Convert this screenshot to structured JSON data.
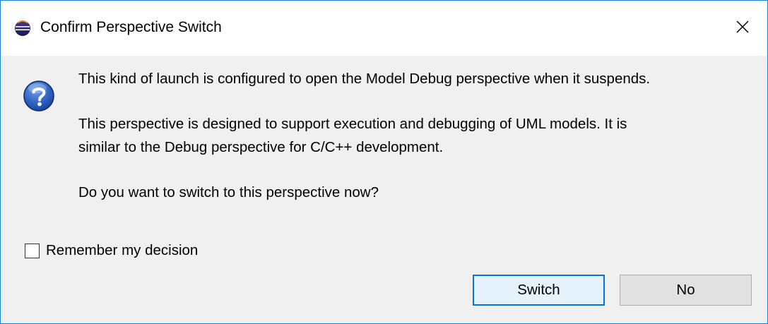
{
  "window": {
    "title": "Confirm Perspective Switch",
    "app_icon": "eclipse-icon",
    "close_icon": "close-icon"
  },
  "dialog": {
    "icon": "question-icon",
    "message_line1": "This kind of launch is configured to open the Model Debug perspective when it suspends.",
    "message_line2": "This perspective is designed to support execution and debugging of UML models. It is",
    "message_line3": "similar to the Debug perspective for C/C++ development.",
    "message_line4": "Do you want to switch to this perspective now?"
  },
  "remember": {
    "label": "Remember my decision",
    "checked": false
  },
  "buttons": {
    "switch_label": "Switch",
    "no_label": "No"
  },
  "colors": {
    "accent": "#0078d7",
    "window_border": "#1883d7",
    "dialog_bg": "#f0f0f0"
  }
}
